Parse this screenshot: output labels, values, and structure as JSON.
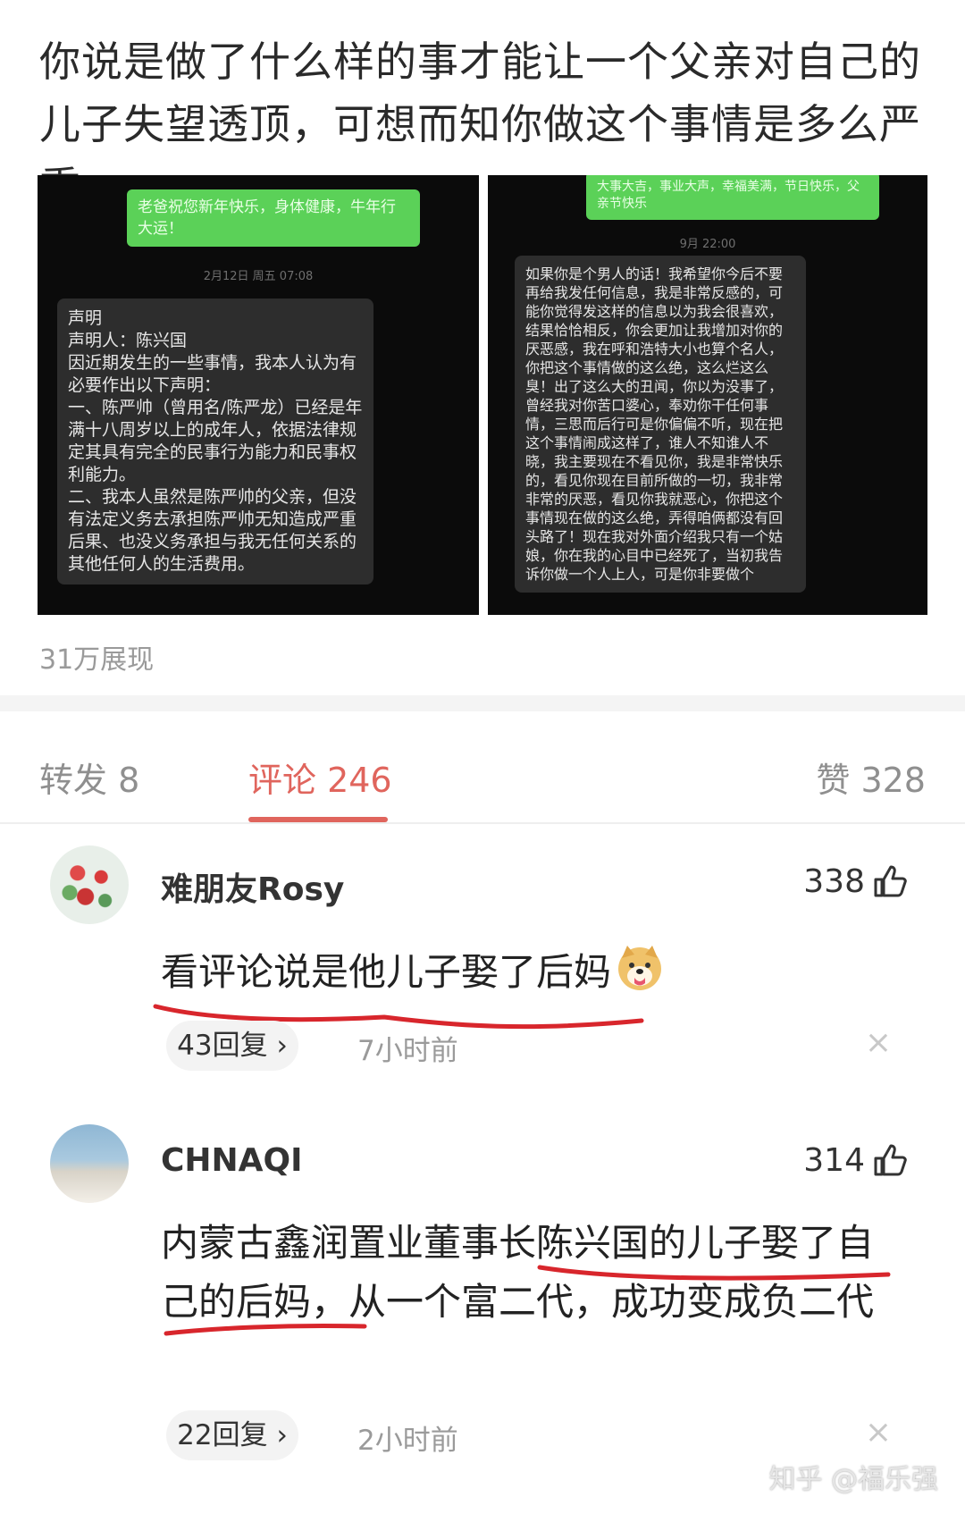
{
  "post": {
    "text": "你说是做了什么样的事才能让一个父亲对自己的儿子失望透顶，可想而知你做这个事情是多么严重。",
    "views": "31万展现"
  },
  "screenshot_left": {
    "green_bubble": "老爸祝您新年快乐，身体健康，牛年行大运！",
    "timestamp": "2月12日 周五 07:08",
    "message": "声明\n声明人：陈兴国\n因近期发生的一些事情，我本人认为有必要作出以下声明：\n一、陈严帅（曾用名/陈严龙）已经是年满十八周岁以上的成年人，依据法律规定其具有完全的民事行为能力和民事权利能力。\n二、我本人虽然是陈严帅的父亲，但没有法定义务去承担陈严帅无知造成严重后果、也没义务承担与我无任何关系的其他任何人的生活费用。"
  },
  "screenshot_right": {
    "green_bubble": "大事大吉，事业大声，幸福美满，节日快乐，父亲节快乐",
    "timestamp": "9月 22:00",
    "message": "如果你是个男人的话！我希望你今后不要再给我发任何信息，我是非常反感的，可能你觉得发这样的信息以为我会很喜欢，结果恰恰相反，你会更加让我增加对你的厌恶感，我在呼和浩特大小也算个名人，你把这个事情做的这么绝，这么烂这么臭！出了这么大的丑闻，你以为没事了，曾经我对你苦口婆心，奉劝你干任何事情，三思而后行可是你偏偏不听，现在把这个事情闹成这样了，谁人不知谁人不晓，我主要现在不看见你，我是非常快乐的，看见你现在目前所做的一切，我非常非常的厌恶，看见你我就恶心，你把这个事情现在做的这么绝，弄得咱俩都没有回头路了！现在我对外面介绍我只有一个姑娘，你在我的心目中已经死了，当初我告诉你做一个人上人，可是你非要做个"
  },
  "tabs": {
    "repost": "转发 8",
    "comments": "评论 246",
    "likes": "赞 328"
  },
  "comments": [
    {
      "username": "难朋友Rosy",
      "likes": "338",
      "text": "看评论说是他儿子娶了后妈",
      "replies": "43回复 ›",
      "time": "7小时前",
      "close": "×"
    },
    {
      "username": "CHNAQI",
      "likes": "314",
      "text": "内蒙古鑫润置业董事长陈兴国的儿子娶了自己的后妈，从一个富二代，成功变成负二代",
      "replies": "22回复 ›",
      "time": "2小时前",
      "close": "×"
    }
  ],
  "watermark": "知乎 @福乐强",
  "colors": {
    "accent": "#e0655d",
    "underline_red": "#d8262c",
    "bubble_green": "#5bd158"
  },
  "icons": [
    "thumbs-up-icon",
    "close-icon",
    "chevron-right-icon",
    "doge-emoji-icon"
  ]
}
